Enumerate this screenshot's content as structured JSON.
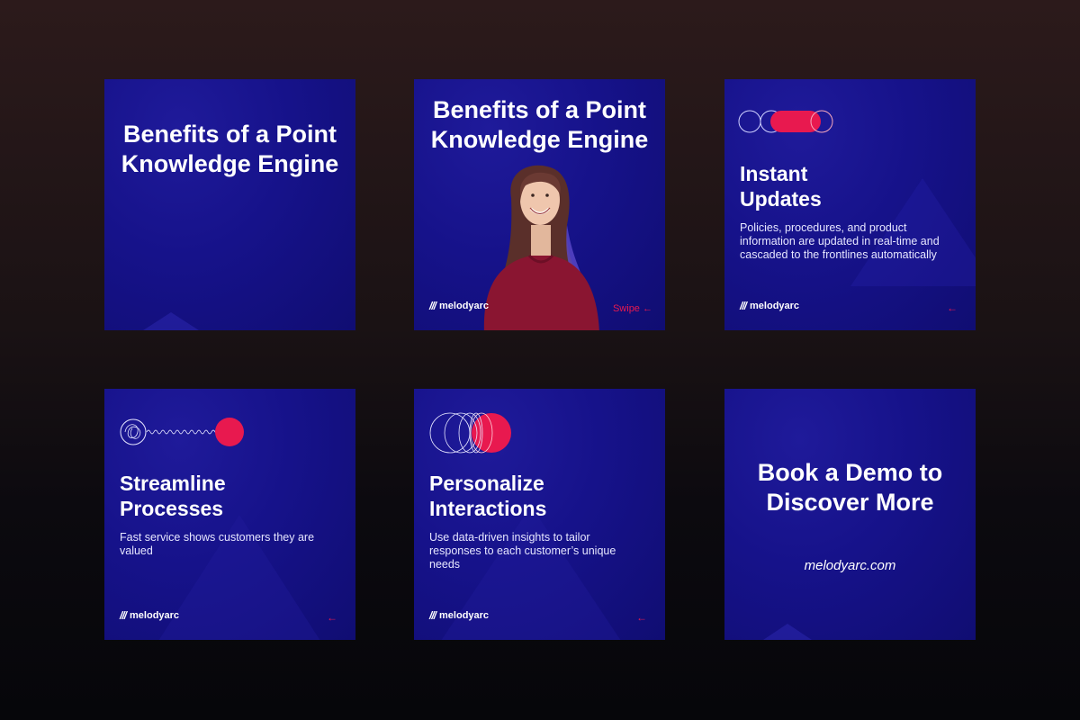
{
  "brand": {
    "name": "melodyarc",
    "website": "melodyarc.com"
  },
  "colors": {
    "accent": "#e8194f",
    "card_bg": "#16128a"
  },
  "cards": [
    {
      "title": "Benefits of a Point Knowledge Engine"
    },
    {
      "title": "Benefits of a Point Knowledge Engine",
      "swipe": "Swipe ←"
    },
    {
      "heading": "Instant Updates",
      "body": "Policies, procedures, and product information are updated in real-time and cascaded to the frontlines automatically",
      "arrow": "←"
    },
    {
      "heading": "Streamline Processes",
      "body": "Fast service shows customers they are valued",
      "arrow": "←"
    },
    {
      "heading": "Personalize Interactions",
      "body": "Use data-driven insights to tailor responses to each customer’s unique needs",
      "arrow": "←"
    },
    {
      "title": "Book a Demo to Discover More"
    }
  ],
  "icons": [
    "circles-merge-icon",
    "scribble-wave-icon",
    "interlocking-rings-icon",
    "melodyarc-logo-icon"
  ]
}
